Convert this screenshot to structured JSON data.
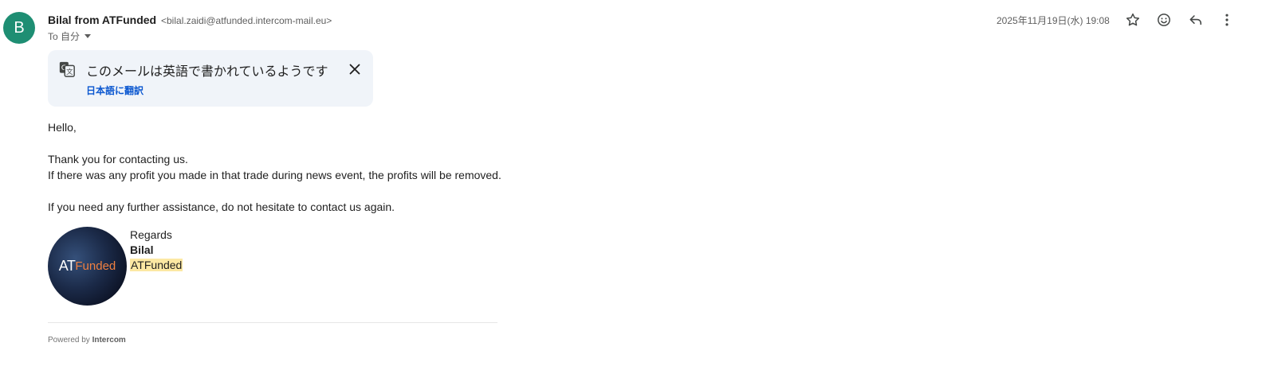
{
  "header": {
    "avatar_letter": "B",
    "sender_name": "Bilal from ATFunded",
    "sender_email": "<bilal.zaidi@atfunded.intercom-mail.eu>",
    "recipient": "To 自分",
    "date": "2025年11月19日(水) 19:08",
    "avatar_color": "#1e8e73",
    "icons": [
      "star-icon",
      "emoji-icon",
      "reply-icon",
      "more-vert-icon"
    ]
  },
  "translate_banner": {
    "title": "このメールは英語で書かれているようです",
    "action": "日本語に翻訳",
    "icons": [
      "translate-icon",
      "close-icon"
    ]
  },
  "body": {
    "greeting": "Hello,",
    "line1": "Thank you for contacting us.",
    "line2": "If there was any profit you made in that trade during news event, the profits will be removed.",
    "line3": "If you need any further assistance, do not hesitate to contact us again."
  },
  "signature": {
    "logo_at": "AT",
    "logo_funded": "Funded",
    "regards": "Regards",
    "name": "Bilal",
    "company": "ATFunded"
  },
  "footer": {
    "powered_by": "Powered by",
    "brand": "Intercom"
  },
  "colors": {
    "accent_link": "#0b57d0",
    "banner_bg": "#f0f4f9",
    "highlight": "#fce8a3",
    "logo_orange": "#f08040"
  }
}
